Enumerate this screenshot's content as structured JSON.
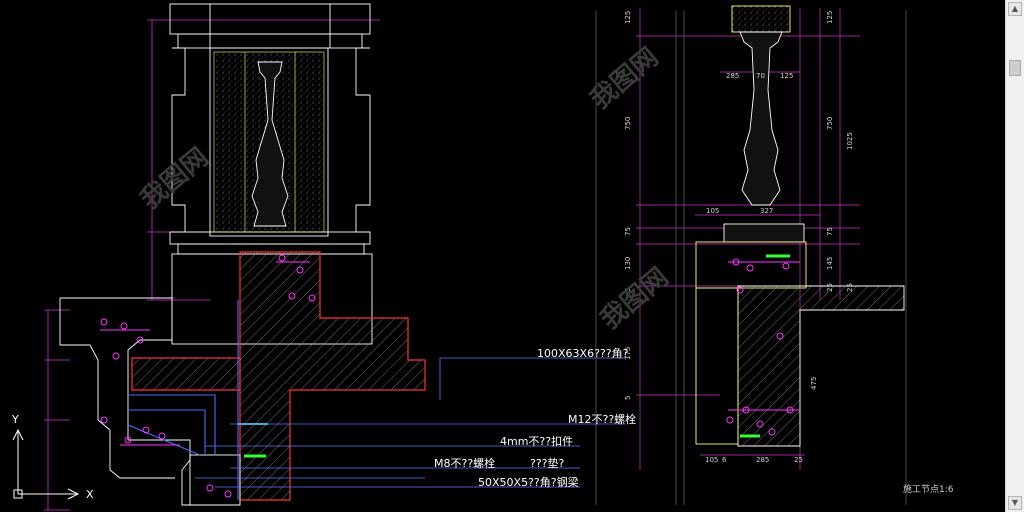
{
  "annotations": {
    "angle_steel": "100X63X6???角?",
    "bolt_m12": "M12不??螺栓",
    "fastener_4mm": "4mm不??扣件",
    "bolt_m8": "M8不??螺栓",
    "pad": "???垫?",
    "steel_50": "50X50X5??角?钢梁"
  },
  "drawing": {
    "title": "施工节点1:6",
    "watermark": "我图网"
  },
  "ucs": {
    "y_label": "Y",
    "x_label": "X"
  },
  "dims_right": {
    "top": [
      "125",
      "750",
      "75",
      "130",
      "5",
      "175",
      "475",
      "25",
      "5"
    ],
    "horizontal": [
      "285",
      "70",
      "125",
      "105",
      "327",
      "105",
      "6",
      "285",
      "25"
    ],
    "side": [
      "125",
      "750",
      "1025",
      "75",
      "145",
      "25"
    ]
  },
  "colors": {
    "background": "#000000",
    "stone": "#ffffff",
    "concrete": "#ff3030",
    "hardware": "#ff33ff",
    "dimension": "#cc33cc",
    "steel": "#4a6cff",
    "fill_green": "#33ff33",
    "cyan": "#33cccc",
    "outline_yellow": "#ffff66"
  },
  "scrollbar": {
    "up": "▲",
    "down": "▼"
  }
}
